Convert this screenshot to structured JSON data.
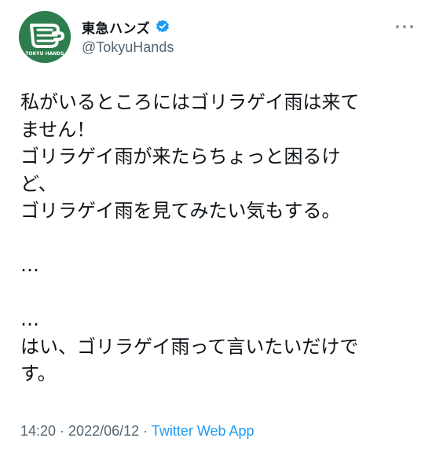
{
  "author": {
    "display_name": "東急ハンズ",
    "handle": "@TokyuHands",
    "avatar_label": "TOKYU HANDS",
    "verified": true
  },
  "tweet": {
    "lines": [
      "私がいるところにはゴリラゲイ雨は来て",
      "ません！",
      "ゴリラゲイ雨が来たらちょっと困るけ",
      "ど、",
      "ゴリラゲイ雨を見てみたい気もする。",
      "",
      "…",
      "",
      "…",
      "はい、ゴリラゲイ雨って言いたいだけで",
      "す。"
    ]
  },
  "meta": {
    "time": "14:20",
    "separator1": " · ",
    "date": "2022/06/12",
    "separator2": " · ",
    "source": "Twitter Web App"
  },
  "icons": {
    "verified": "verified-badge-icon",
    "more": "more-options-icon"
  },
  "colors": {
    "avatar_bg": "#2e7d4e",
    "verified": "#1d9bf0",
    "link": "#1d9bf0",
    "muted": "#536471",
    "text": "#0f1419"
  }
}
